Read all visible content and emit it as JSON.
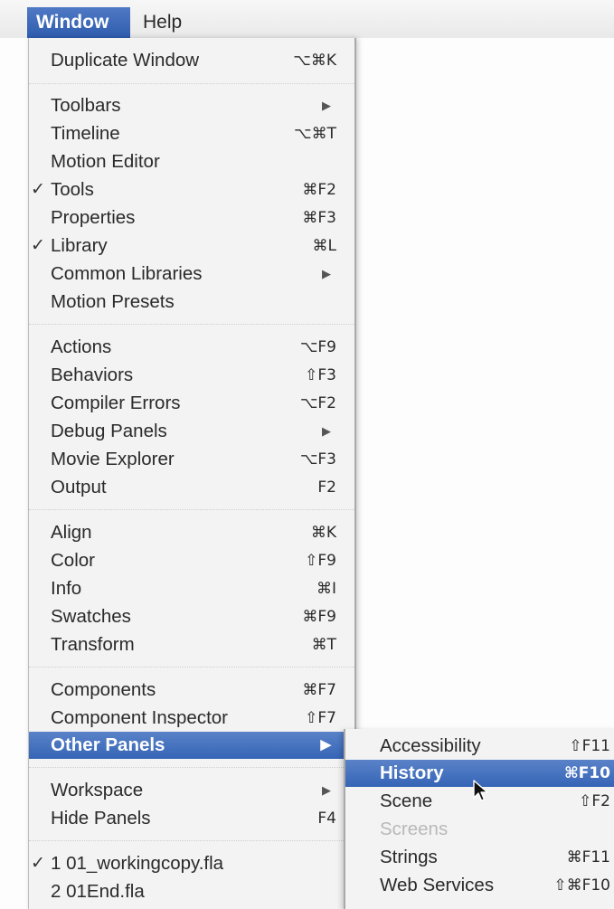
{
  "menubar": {
    "window_label": "Window",
    "help_label": "Help"
  },
  "window_menu": {
    "items": [
      {
        "label": "Duplicate Window",
        "shortcut": "⌥⌘K"
      },
      {
        "label": "Toolbars",
        "shortcut": ""
      },
      {
        "label": "Timeline",
        "shortcut": "⌥⌘T"
      },
      {
        "label": "Motion Editor",
        "shortcut": ""
      },
      {
        "label": "Tools",
        "shortcut": "⌘F2",
        "check": "✓"
      },
      {
        "label": "Properties",
        "shortcut": "⌘F3"
      },
      {
        "label": "Library",
        "shortcut": "⌘L",
        "check": "✓"
      },
      {
        "label": "Common Libraries",
        "shortcut": ""
      },
      {
        "label": "Motion Presets",
        "shortcut": ""
      },
      {
        "label": "Actions",
        "shortcut": "⌥F9"
      },
      {
        "label": "Behaviors",
        "shortcut": "⇧F3"
      },
      {
        "label": "Compiler Errors",
        "shortcut": "⌥F2"
      },
      {
        "label": "Debug Panels",
        "shortcut": ""
      },
      {
        "label": "Movie Explorer",
        "shortcut": "⌥F3"
      },
      {
        "label": "Output",
        "shortcut": "F2"
      },
      {
        "label": "Align",
        "shortcut": "⌘K"
      },
      {
        "label": "Color",
        "shortcut": "⇧F9"
      },
      {
        "label": "Info",
        "shortcut": "⌘I"
      },
      {
        "label": "Swatches",
        "shortcut": "⌘F9"
      },
      {
        "label": "Transform",
        "shortcut": "⌘T"
      },
      {
        "label": "Components",
        "shortcut": "⌘F7"
      },
      {
        "label": "Component Inspector",
        "shortcut": "⇧F7"
      },
      {
        "label": "Other Panels",
        "shortcut": ""
      },
      {
        "label": "Workspace",
        "shortcut": ""
      },
      {
        "label": "Hide Panels",
        "shortcut": "F4"
      },
      {
        "label": "1 01_workingcopy.fla",
        "shortcut": "",
        "check": "✓"
      },
      {
        "label": "2 01End.fla",
        "shortcut": ""
      }
    ],
    "submenu_arrow": "▶"
  },
  "other_panels_submenu": {
    "items": [
      {
        "label": "Accessibility",
        "shortcut": "⇧F11"
      },
      {
        "label": "History",
        "shortcut": "⌘F10"
      },
      {
        "label": "Scene",
        "shortcut": "⇧F2"
      },
      {
        "label": "Screens",
        "shortcut": ""
      },
      {
        "label": "Strings",
        "shortcut": "⌘F11"
      },
      {
        "label": "Web Services",
        "shortcut": "⇧⌘F10"
      }
    ]
  },
  "icons": {
    "check": "checkmark-icon",
    "arrow": "submenu-arrow-icon",
    "cursor": "mouse-pointer-icon"
  },
  "colors": {
    "highlight": "#3565b6",
    "menu_bg": "#f3f3f3",
    "disabled": "#b9b9b9"
  }
}
